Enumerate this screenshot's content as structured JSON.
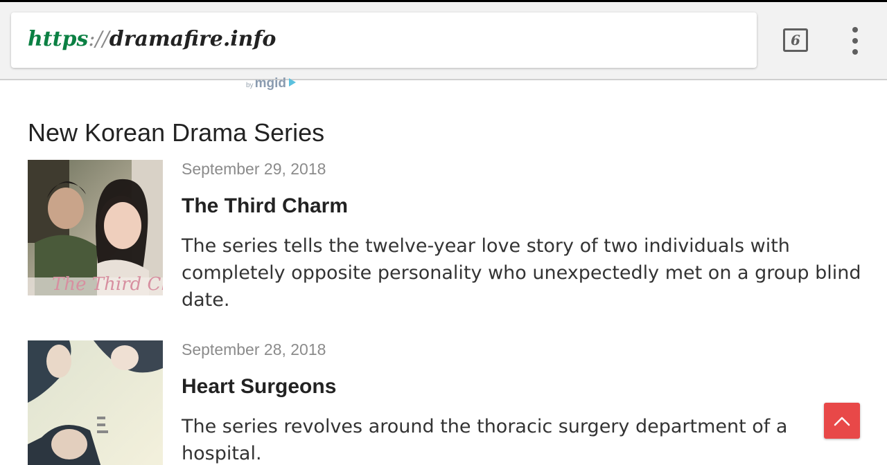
{
  "browser": {
    "url_scheme": "https",
    "url_separator": "://",
    "url_domain": "dramafire.info",
    "tab_count": "6",
    "menu_icon": "more-vert-icon"
  },
  "ad": {
    "by_label": "by",
    "brand": "mgid"
  },
  "section": {
    "title": "New Korean Drama Series"
  },
  "articles": [
    {
      "date": "September 29, 2018",
      "title": "The Third Charm",
      "description": "The series tells the twelve-year love story of two individuals with completely opposite personality who unexpectedly met on a group blind date.",
      "poster_text": "The Third Charm"
    },
    {
      "date": "September 28, 2018",
      "title": "Heart Surgeons",
      "description": "The series revolves around the thoracic surgery department of a hospital."
    }
  ],
  "colors": {
    "url_scheme": "#0b8043",
    "scroll_top_button": "#e84848"
  },
  "scroll_top_icon": "chevron-up-icon"
}
